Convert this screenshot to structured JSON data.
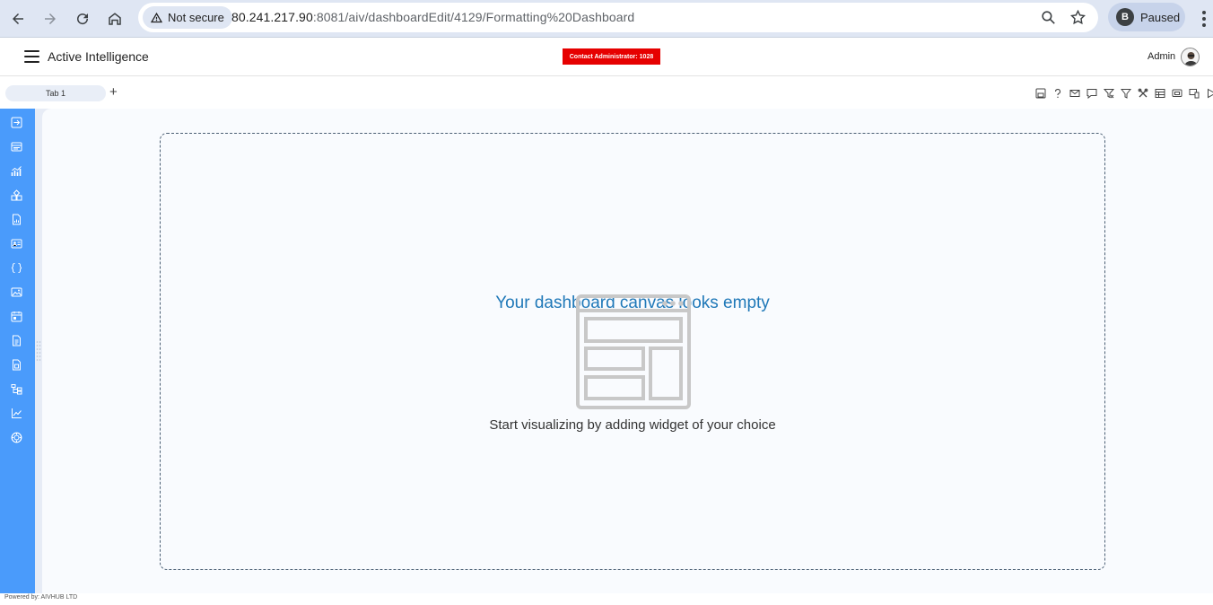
{
  "browser": {
    "security_label": "Not secure",
    "url_host": "80.241.217.90",
    "url_rest": ":8081/aiv/dashboardEdit/4129/Formatting%20Dashboard",
    "profile_initial": "B",
    "profile_status": "Paused"
  },
  "header": {
    "brand": "Active Intelligence",
    "license_notice": "Contact Administrator: 1028",
    "user_name": "Admin"
  },
  "tabs": [
    {
      "label": "Tab 1",
      "active": true
    }
  ],
  "toolbar_icons": [
    "save-icon",
    "help-icon",
    "mail-icon",
    "comment-icon",
    "clear-filter-icon",
    "filter-icon",
    "tools-icon",
    "table-icon",
    "preview-icon",
    "responsive-icon",
    "play-icon"
  ],
  "sidebar_icons": [
    "import-icon",
    "card-icon",
    "chart-icon",
    "widgets-icon",
    "report-icon",
    "profile-card-icon",
    "code-block-icon",
    "image-icon",
    "calendar-icon",
    "document-icon",
    "file-icon",
    "tree-icon",
    "trend-icon",
    "gauge-icon"
  ],
  "canvas": {
    "empty_title": "Your dashboard canvas looks empty",
    "empty_subtitle": "Start visualizing by adding widget of your choice"
  },
  "footer": {
    "powered_by": "Powered by: AIVHUB LTD"
  },
  "colors": {
    "sidebar": "#4a9bfb",
    "accent_text": "#1f78b8",
    "license_badge": "#e60000",
    "workspace_bg": "#e7ecf6"
  }
}
